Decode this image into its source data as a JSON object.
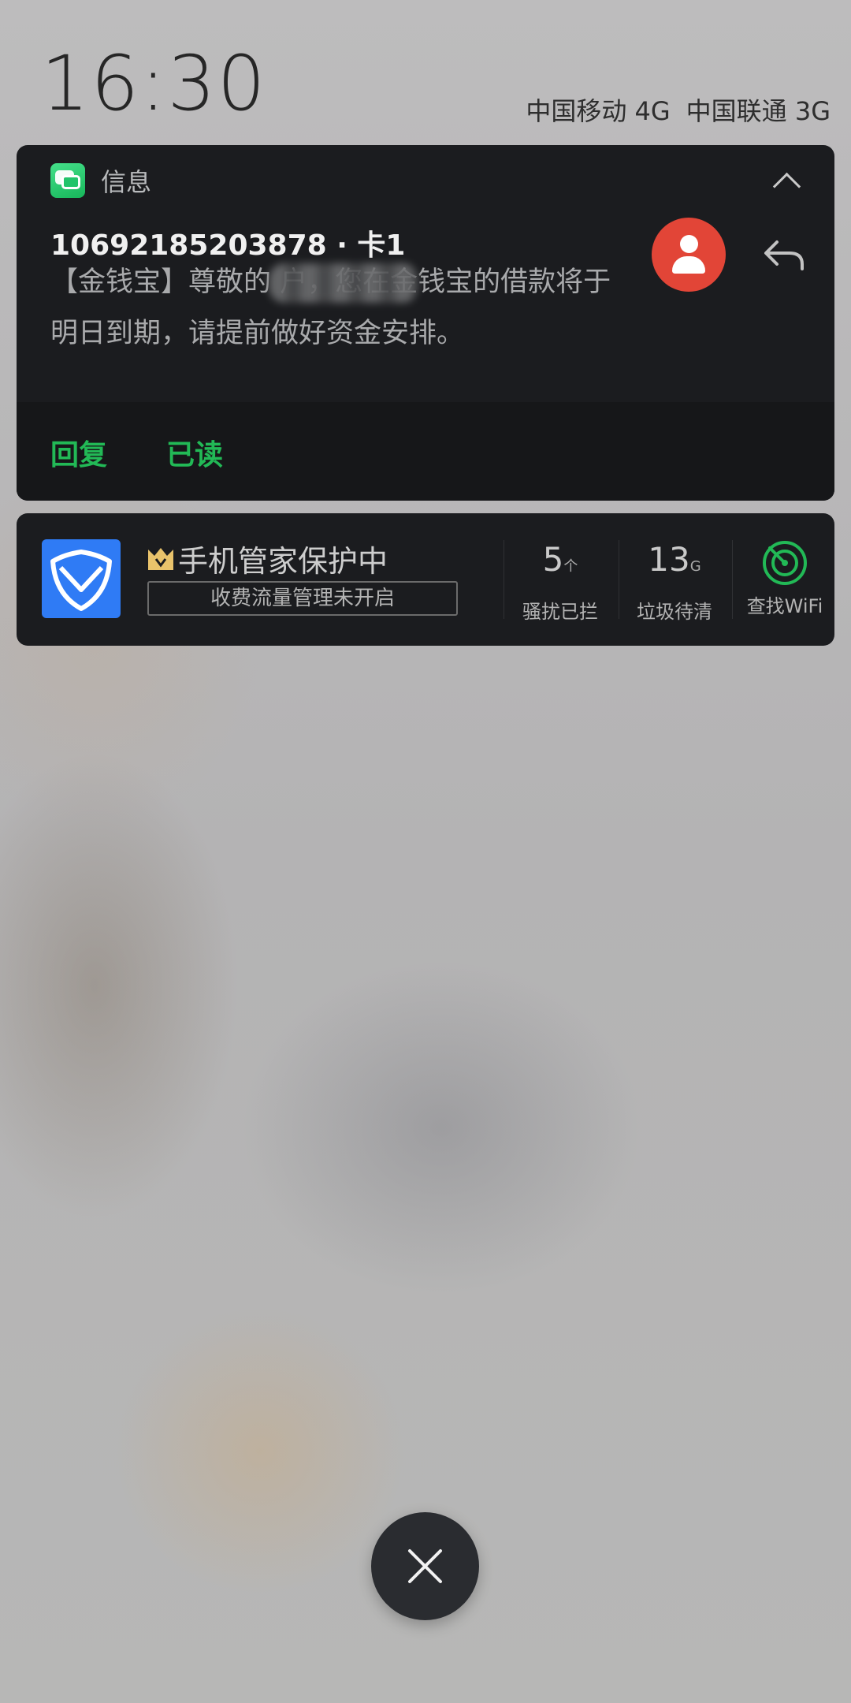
{
  "status": {
    "time": "16:30",
    "carrier_1": "中国移动 4G",
    "carrier_2": "中国联通 3G"
  },
  "message_notification": {
    "app_name": "信息",
    "sender": "10692185203878 · 卡1",
    "body": "【金钱宝】尊敬的        户，您在金钱宝的借款将于明日到期，请提前做好资金安排。",
    "actions": {
      "reply_label": "回复",
      "mark_read_label": "已读"
    },
    "accent_color": "#22b956",
    "avatar_color": "#e24537"
  },
  "security_notification": {
    "title": "手机管家保护中",
    "subtitle": "收费流量管理未开启",
    "stats": [
      {
        "value": "5",
        "unit": "个",
        "label": "骚扰已拦"
      },
      {
        "value": "13",
        "unit": "G",
        "label": "垃圾待清"
      }
    ],
    "wifi_label": "查找WiFi",
    "icon_color": "#2f7bf5"
  },
  "icons": {
    "collapse": "chevron-up-icon",
    "reply": "reply-arrow-icon",
    "dismiss": "close-icon"
  }
}
